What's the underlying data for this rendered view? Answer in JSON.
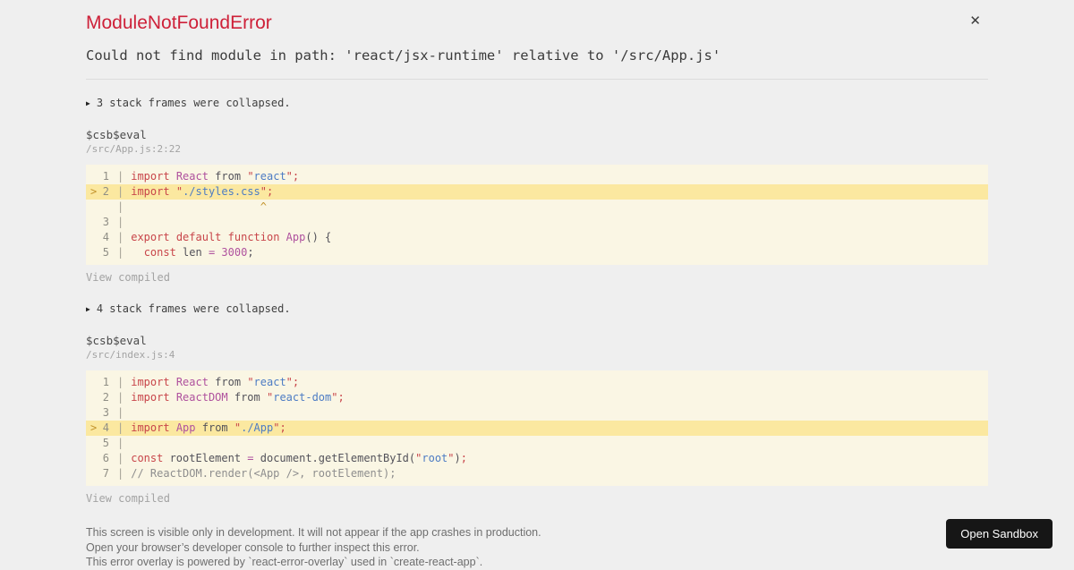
{
  "overlay": {
    "title": "ModuleNotFoundError",
    "message": "Could not find module in path: 'react/jsx-runtime' relative to '/src/App.js'",
    "close_icon": "✕"
  },
  "colors": {
    "title_red": "#ce2139",
    "page_background": "#efefef",
    "code_background": "#faf6e4",
    "highlight_line": "#fbe8a0",
    "keyword": "#c8454a",
    "identifier": "#af519e",
    "string": "#4d7cc4",
    "comment": "#8e8e8e",
    "marker_amber": "#c3942c",
    "button_background": "#161616"
  },
  "frames": [
    {
      "collapsed_toggle": {
        "icon": "▶",
        "label": "3 stack frames were collapsed."
      },
      "function_name": "$csb$eval",
      "location": "/src/App.js:2:22",
      "view_compiled_label": "View compiled",
      "code_lines": [
        {
          "num": "1",
          "marker": "",
          "highlight": false,
          "segments": [
            {
              "c": "kw",
              "t": "import"
            },
            {
              "c": "pl",
              "t": " "
            },
            {
              "c": "id",
              "t": "React"
            },
            {
              "c": "pl",
              "t": " from "
            },
            {
              "c": "q",
              "t": "\""
            },
            {
              "c": "str",
              "t": "react"
            },
            {
              "c": "q",
              "t": "\";"
            }
          ]
        },
        {
          "num": "2",
          "marker": ">",
          "highlight": true,
          "segments": [
            {
              "c": "kw",
              "t": "import"
            },
            {
              "c": "pl",
              "t": " "
            },
            {
              "c": "q",
              "t": "\""
            },
            {
              "c": "str",
              "t": "./styles.css"
            },
            {
              "c": "q",
              "t": "\";"
            }
          ]
        },
        {
          "num": "",
          "marker": "",
          "highlight": false,
          "segments": [
            {
              "c": "pl",
              "t": "                    "
            },
            {
              "c": "caret",
              "t": "^"
            }
          ]
        },
        {
          "num": "3",
          "marker": "",
          "highlight": false,
          "segments": []
        },
        {
          "num": "4",
          "marker": "",
          "highlight": false,
          "segments": [
            {
              "c": "kw",
              "t": "export"
            },
            {
              "c": "pl",
              "t": " "
            },
            {
              "c": "kw",
              "t": "default"
            },
            {
              "c": "pl",
              "t": " "
            },
            {
              "c": "kw",
              "t": "function"
            },
            {
              "c": "pl",
              "t": " "
            },
            {
              "c": "id",
              "t": "App"
            },
            {
              "c": "pl",
              "t": "() {"
            }
          ]
        },
        {
          "num": "5",
          "marker": "",
          "highlight": false,
          "segments": [
            {
              "c": "pl",
              "t": "  "
            },
            {
              "c": "kw",
              "t": "const"
            },
            {
              "c": "pl",
              "t": " len "
            },
            {
              "c": "op",
              "t": "="
            },
            {
              "c": "pl",
              "t": " "
            },
            {
              "c": "op",
              "t": "3000"
            },
            {
              "c": "pl",
              "t": ";"
            }
          ]
        }
      ]
    },
    {
      "collapsed_toggle": {
        "icon": "▶",
        "label": "4 stack frames were collapsed."
      },
      "function_name": "$csb$eval",
      "location": "/src/index.js:4",
      "view_compiled_label": "View compiled",
      "code_lines": [
        {
          "num": "1",
          "marker": "",
          "highlight": false,
          "segments": [
            {
              "c": "kw",
              "t": "import"
            },
            {
              "c": "pl",
              "t": " "
            },
            {
              "c": "id",
              "t": "React"
            },
            {
              "c": "pl",
              "t": " from "
            },
            {
              "c": "q",
              "t": "\""
            },
            {
              "c": "str",
              "t": "react"
            },
            {
              "c": "q",
              "t": "\";"
            }
          ]
        },
        {
          "num": "2",
          "marker": "",
          "highlight": false,
          "segments": [
            {
              "c": "kw",
              "t": "import"
            },
            {
              "c": "pl",
              "t": " "
            },
            {
              "c": "id",
              "t": "ReactDOM"
            },
            {
              "c": "pl",
              "t": " from "
            },
            {
              "c": "q",
              "t": "\""
            },
            {
              "c": "str",
              "t": "react-dom"
            },
            {
              "c": "q",
              "t": "\";"
            }
          ]
        },
        {
          "num": "3",
          "marker": "",
          "highlight": false,
          "segments": []
        },
        {
          "num": "4",
          "marker": ">",
          "highlight": true,
          "segments": [
            {
              "c": "kw",
              "t": "import"
            },
            {
              "c": "pl",
              "t": " "
            },
            {
              "c": "id",
              "t": "App"
            },
            {
              "c": "pl",
              "t": " from "
            },
            {
              "c": "q",
              "t": "\""
            },
            {
              "c": "str",
              "t": "./App"
            },
            {
              "c": "q",
              "t": "\";"
            }
          ]
        },
        {
          "num": "5",
          "marker": "",
          "highlight": false,
          "segments": []
        },
        {
          "num": "6",
          "marker": "",
          "highlight": false,
          "segments": [
            {
              "c": "kw",
              "t": "const"
            },
            {
              "c": "pl",
              "t": " rootElement "
            },
            {
              "c": "op",
              "t": "="
            },
            {
              "c": "pl",
              "t": " document.getElementById("
            },
            {
              "c": "q",
              "t": "\""
            },
            {
              "c": "str",
              "t": "root"
            },
            {
              "c": "q",
              "t": "\""
            },
            {
              "c": "pl",
              "t": ")"
            },
            {
              "c": "q",
              "t": ";"
            }
          ]
        },
        {
          "num": "7",
          "marker": "",
          "highlight": false,
          "segments": [
            {
              "c": "cm",
              "t": "// ReactDOM.render(<App />, rootElement);"
            }
          ]
        }
      ]
    }
  ],
  "footer": {
    "notes": [
      "This screen is visible only in development. It will not appear if the app crashes in production.",
      "Open your browser’s developer console to further inspect this error.",
      "This error overlay is powered by `react-error-overlay` used in `create-react-app`."
    ],
    "open_sandbox_label": "Open Sandbox"
  }
}
